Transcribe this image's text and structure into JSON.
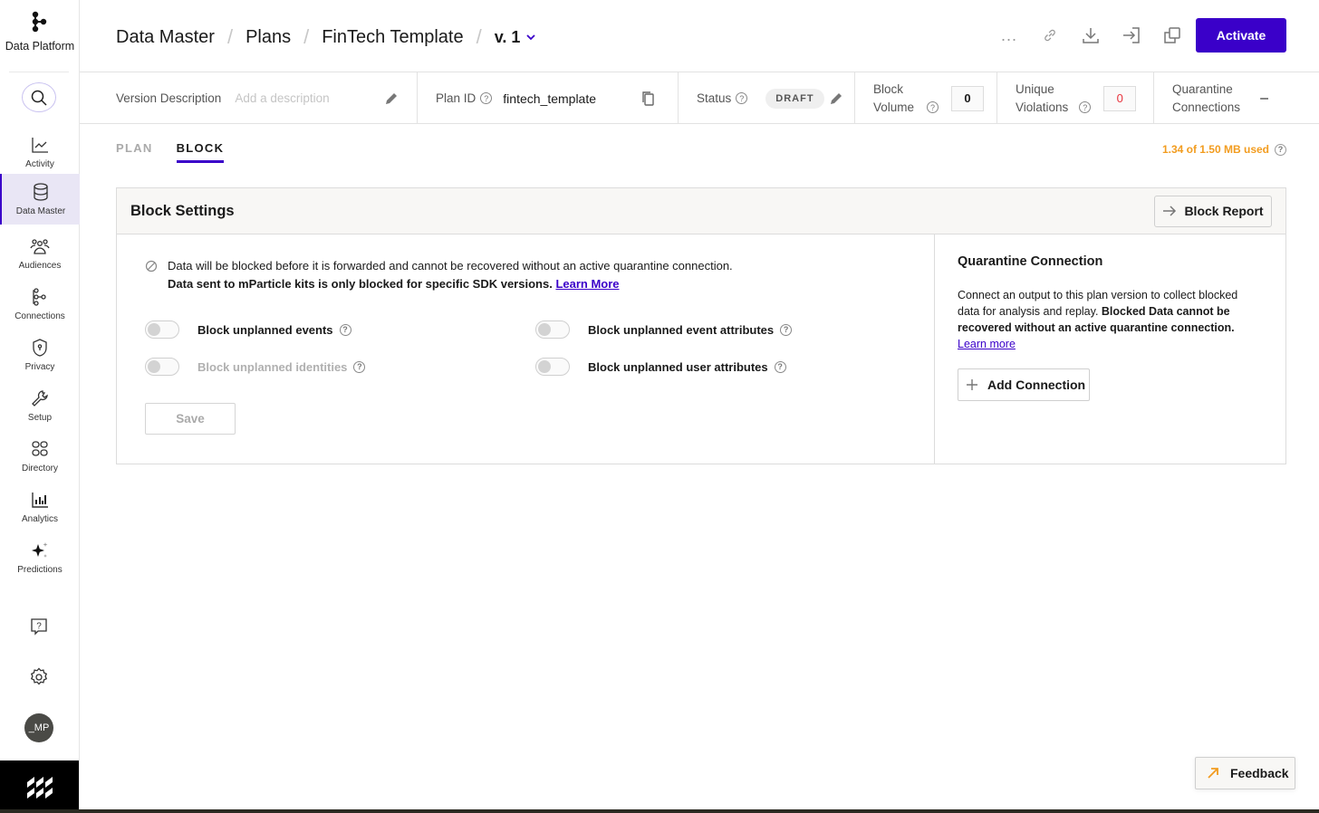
{
  "sidebar": {
    "brand_label": "Data Platform",
    "search_icon": "search-icon",
    "items": [
      {
        "label": "Activity",
        "icon": "activity-chart-icon",
        "active": false
      },
      {
        "label": "Data Master",
        "icon": "database-icon",
        "active": true
      },
      {
        "label": "Audiences",
        "icon": "audiences-icon",
        "active": false
      },
      {
        "label": "Connections",
        "icon": "connections-icon",
        "active": false
      },
      {
        "label": "Privacy",
        "icon": "shield-icon",
        "active": false
      },
      {
        "label": "Setup",
        "icon": "wrench-icon",
        "active": false
      },
      {
        "label": "Directory",
        "icon": "grid-icon",
        "active": false
      },
      {
        "label": "Analytics",
        "icon": "bar-chart-icon",
        "active": false
      },
      {
        "label": "Predictions",
        "icon": "sparkle-icon",
        "active": false
      }
    ],
    "help_icon": "help-chat-icon",
    "settings_icon": "gear-icon",
    "avatar_initials": "_MP"
  },
  "header": {
    "breadcrumbs": [
      "Data Master",
      "Plans",
      "FinTech Template"
    ],
    "version": "v. 1",
    "more_label": "...",
    "activate_label": "Activate"
  },
  "meta": {
    "version_description_label": "Version Description",
    "version_description_placeholder": "Add a description",
    "version_description_value": "",
    "plan_id_label": "Plan ID",
    "plan_id_value": "fintech_template",
    "status_label": "Status",
    "status_value": "DRAFT",
    "block_volume_label_1": "Block",
    "block_volume_label_2": "Volume",
    "block_volume_value": "0",
    "unique_violations_label_1": "Unique",
    "unique_violations_label_2": "Violations",
    "unique_violations_value": "0",
    "quarantine_label_1": "Quarantine",
    "quarantine_label_2": "Connections",
    "quarantine_value": "–"
  },
  "tabs": [
    {
      "label": "PLAN",
      "active": false
    },
    {
      "label": "BLOCK",
      "active": true
    }
  ],
  "usage_text": "1.34 of 1.50 MB used",
  "block_settings": {
    "title": "Block Settings",
    "report_button": "Block Report",
    "notice_line1": "Data will be blocked before it is forwarded and cannot be recovered without an active quarantine connection.",
    "notice_line2": "Data sent to mParticle kits is only blocked for specific SDK versions.",
    "notice_link": "Learn More",
    "toggles": [
      {
        "label": "Block unplanned events",
        "on": false,
        "disabled": false
      },
      {
        "label": "Block unplanned event attributes",
        "on": false,
        "disabled": false
      },
      {
        "label": "Block unplanned identities",
        "on": false,
        "disabled": true
      },
      {
        "label": "Block unplanned user attributes",
        "on": false,
        "disabled": false
      }
    ],
    "save_label": "Save"
  },
  "quarantine": {
    "title": "Quarantine Connection",
    "text_plain": "Connect an output to this plan version to collect blocked data for analysis and replay.",
    "text_bold": "Blocked Data cannot be recovered without an active quarantine connection.",
    "link": "Learn more",
    "add_button": "Add Connection"
  },
  "feedback_label": "Feedback",
  "colors": {
    "accent": "#3a00c9",
    "usage_warning": "#f29c1f",
    "violation": "#e8323c"
  }
}
